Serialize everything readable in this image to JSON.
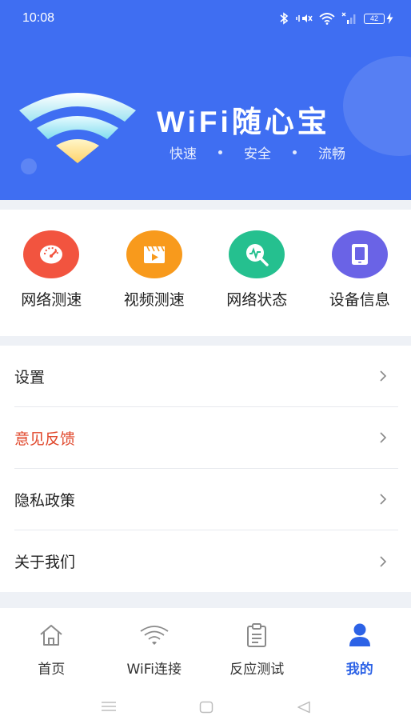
{
  "status_bar": {
    "time": "10:08",
    "battery": "42"
  },
  "header": {
    "title": "WiFi随心宝",
    "tagline": [
      "快速",
      "安全",
      "流畅"
    ]
  },
  "tools": [
    {
      "label": "网络测速",
      "icon": "speedometer-icon",
      "color": "#f2543f"
    },
    {
      "label": "视频测速",
      "icon": "video-clapper-icon",
      "color": "#f89a1c"
    },
    {
      "label": "网络状态",
      "icon": "network-search-icon",
      "color": "#25c08f"
    },
    {
      "label": "设备信息",
      "icon": "tablet-icon",
      "color": "#6a63e6"
    }
  ],
  "menu": [
    {
      "label": "设置"
    },
    {
      "label": "意见反馈"
    },
    {
      "label": "隐私政策"
    },
    {
      "label": "关于我们"
    }
  ],
  "bottom_nav": [
    {
      "label": "首页",
      "icon": "home-icon"
    },
    {
      "label": "WiFi连接",
      "icon": "wifi-icon"
    },
    {
      "label": "反应测试",
      "icon": "clipboard-icon"
    },
    {
      "label": "我的",
      "icon": "user-icon",
      "active": true
    }
  ],
  "colors": {
    "brand": "#3f6ef2",
    "accent_text": "#e0472b",
    "active_nav": "#2c62e6"
  }
}
